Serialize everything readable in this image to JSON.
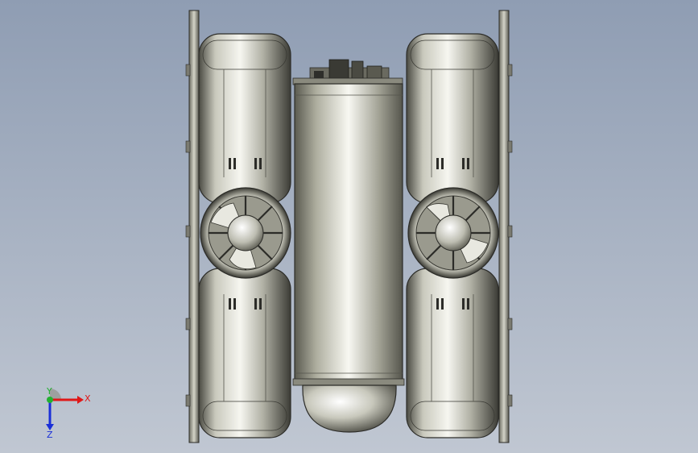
{
  "viewport": {
    "background_top": "#8f9db3",
    "background_bottom": "#c0c7d2"
  },
  "model": {
    "components": [
      "left-frame-plate",
      "right-frame-plate",
      "left-upper-float-tank",
      "left-lower-float-tank",
      "right-upper-float-tank",
      "right-lower-float-tank",
      "left-thruster",
      "right-thruster",
      "central-pressure-cylinder",
      "electronics-housing",
      "dome-cap"
    ],
    "colors": {
      "metal_light": "#f4f4ee",
      "metal_mid": "#b9b9ad",
      "metal_dark": "#505048",
      "edge": "#2c2c28"
    }
  },
  "triad": {
    "x_label": "X",
    "y_label": "Y",
    "z_label": "Z",
    "x_color": "#e01818",
    "y_color": "#22b030",
    "z_color": "#1a2fd8"
  }
}
